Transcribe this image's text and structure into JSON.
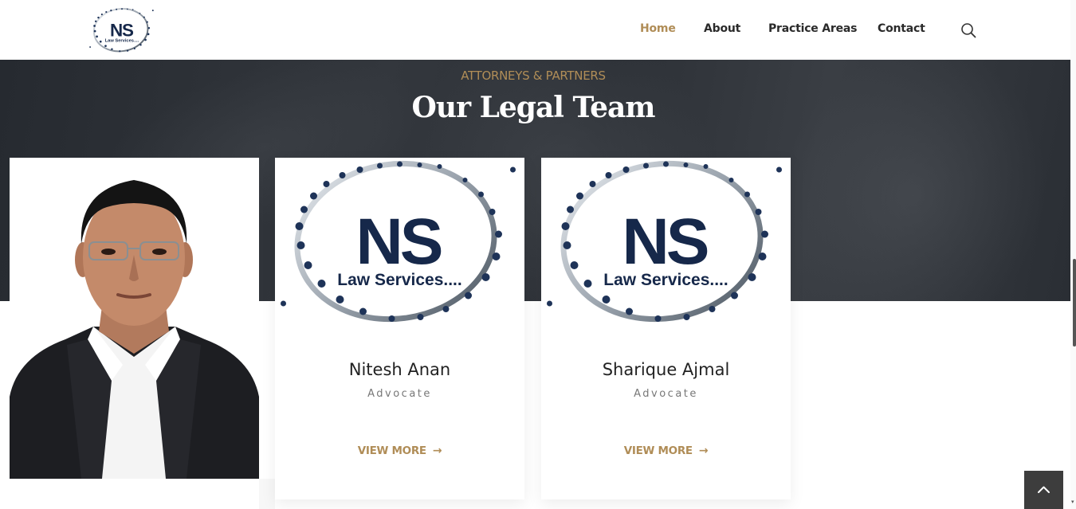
{
  "brand": {
    "logo_text": "NS",
    "logo_sub": "Law Services...."
  },
  "nav": {
    "items": [
      {
        "label": "Home",
        "active": true
      },
      {
        "label": "About",
        "active": false
      },
      {
        "label": "Practice Areas",
        "active": false
      },
      {
        "label": "Contact",
        "active": false
      }
    ],
    "search_icon": "search-icon"
  },
  "section": {
    "eyebrow": "ATTORNEYS & PARTNERS",
    "title": "Our Legal Team"
  },
  "team": [
    {
      "photo": "portrait",
      "name": "",
      "role": ""
    },
    {
      "photo": "ns-logo",
      "name": "Nitesh Anan",
      "role": "Advocate",
      "cta": "VIEW MORE"
    },
    {
      "photo": "ns-logo",
      "name": "Sharique Ajmal",
      "role": "Advocate",
      "cta": "VIEW MORE"
    }
  ],
  "colors": {
    "accent": "#b08d57",
    "dark": "#2a2e34",
    "text": "#222222"
  },
  "scroll_top_icon": "chevron-up-icon"
}
